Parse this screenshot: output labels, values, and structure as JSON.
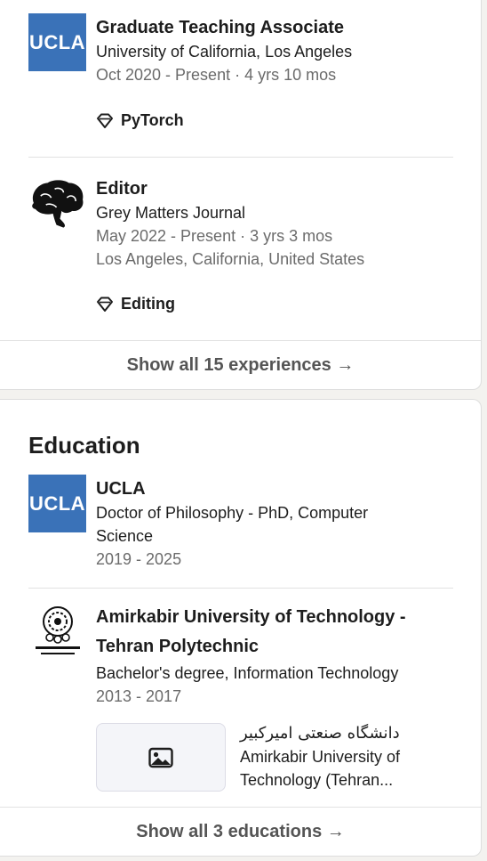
{
  "experience": {
    "items": [
      {
        "logo_text": "UCLA",
        "title": "Graduate Teaching Associate",
        "org": "University of California, Los Angeles",
        "dates": "Oct 2020 - Present · 4 yrs 10 mos",
        "skill": "PyTorch"
      },
      {
        "logo": "brain-icon",
        "title": "Editor",
        "org": "Grey Matters Journal",
        "dates": "May 2022 - Present · 3 yrs 3 mos",
        "location": "Los Angeles, California, United States",
        "skill": "Editing"
      }
    ],
    "show_all": "Show all 15 experiences →"
  },
  "education": {
    "heading": "Education",
    "items": [
      {
        "logo_text": "UCLA",
        "school": "UCLA",
        "degree_line1": "Doctor of Philosophy - PhD, Computer",
        "degree_line2": "Science",
        "years": "2019 - 2025"
      },
      {
        "logo": "amirkabir-seal-icon",
        "school_line1": "Amirkabir University of Technology -",
        "school_line2": "Tehran Polytechnic",
        "degree": "Bachelor's degree, Information Technology",
        "years": "2013 - 2017",
        "media": {
          "icon": "image-icon",
          "title_fa": "دانشگاه صنعتی امیرکبیر",
          "desc_line1": "Amirkabir University of",
          "desc_line2": "Technology (Tehran..."
        }
      }
    ],
    "show_all": "Show all 3 educations →"
  },
  "colors": {
    "ucla_blue": "#3a72b8",
    "page_bg": "#f3f2ef",
    "muted_text": "#6b6b6b"
  }
}
